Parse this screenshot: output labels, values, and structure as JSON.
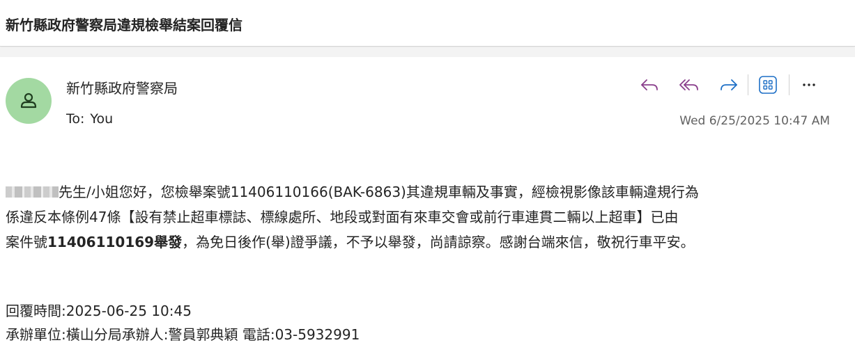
{
  "subject": "新竹縣政府警察局違規檢舉結案回覆信",
  "sender": {
    "name": "新竹縣政府警察局",
    "avatar_color": "#a3d9a2"
  },
  "recipient": {
    "label": "To:",
    "value": "You"
  },
  "date": "Wed 6/25/2025 10:47 AM",
  "toolbar": {
    "reply": "reply-icon",
    "reply_all": "reply-all-icon",
    "forward": "forward-icon",
    "apps": "apps-icon",
    "more": "more-icon",
    "accent_color": "#8a3f8c",
    "forward_color": "#1d6fc6"
  },
  "body": {
    "line1_after_redaction": "先生/小姐您好，您檢舉案號11406110166(BAK-6863)其違規車輛及事實，經檢視影像該車輛違規行為",
    "line2": "係違反本條例47條【設有禁止超車標誌、標線處所、地段或對面有來車交會或前行車連貫二輛以上超車】已由",
    "line3_prefix": "案件號",
    "line3_bold": "11406110169舉發",
    "line3_suffix": "，為免日後作(舉)證爭議，不予以舉發，尚請諒察。感謝台端來信，敬祝行車平安。"
  },
  "meta": {
    "reply_time": "回覆時間:2025-06-25 10:45",
    "handler": "承辦單位:橫山分局承辦人:警員郭典穎 電話:03-5932991"
  }
}
